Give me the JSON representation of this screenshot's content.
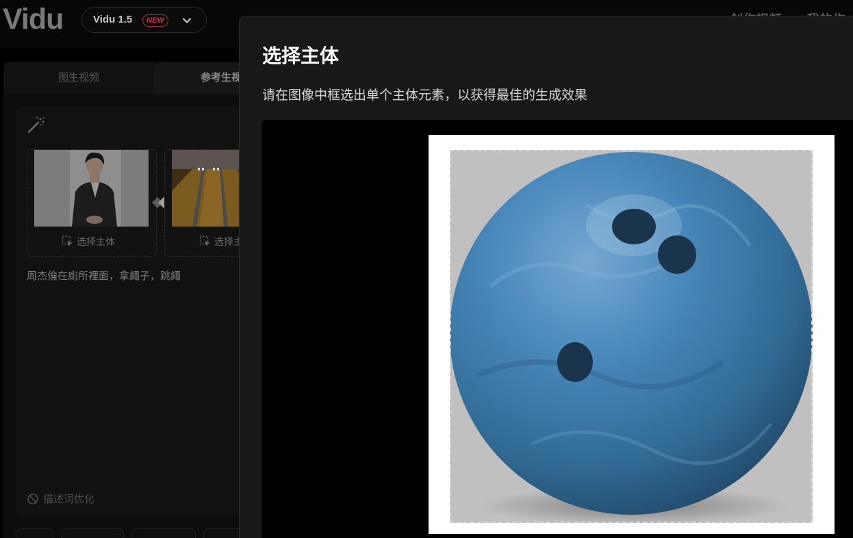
{
  "header": {
    "logo": "Vidu",
    "model": {
      "name": "Vidu 1.5",
      "badge": "NEW"
    },
    "nav": [
      "创作视频",
      "我的作"
    ]
  },
  "tabs": [
    {
      "label": "图生视频"
    },
    {
      "label": "参考生视"
    }
  ],
  "reference": {
    "slots": [
      {
        "label": "选择主体",
        "image": "person-photo"
      },
      {
        "label": "选择主体",
        "image": "bowling-alley-photo"
      }
    ],
    "prompt": "周杰倫在廁所裡面，拿繩子，跳繩",
    "optimize_label": "描述词优化"
  },
  "modal": {
    "title": "选择主体",
    "subtitle": "请在图像中框选出单个主体元素，以获得最佳的生成效果",
    "image": "bowling-ball-photo"
  },
  "colors": {
    "accent_new": "#d0344a",
    "ball_blue": "#2e6fa5",
    "modal_bg": "#181818"
  }
}
